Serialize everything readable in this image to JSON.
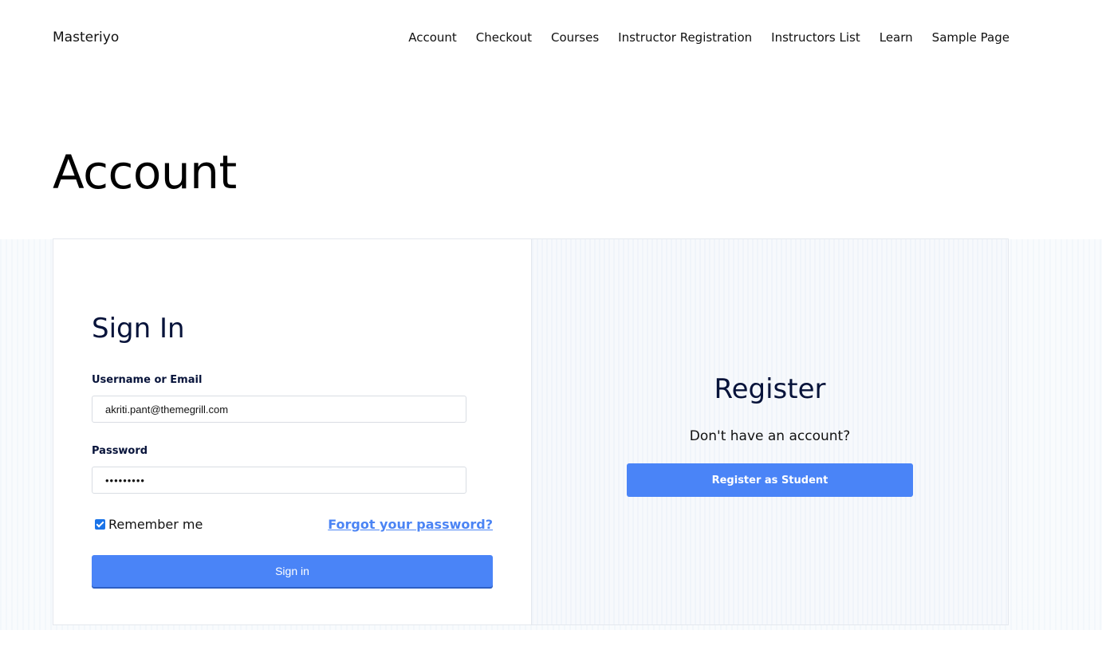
{
  "header": {
    "site_title": "Masteriyo",
    "nav": [
      {
        "label": "Account"
      },
      {
        "label": "Checkout"
      },
      {
        "label": "Courses"
      },
      {
        "label": "Instructor Registration"
      },
      {
        "label": "Instructors List"
      },
      {
        "label": "Learn"
      },
      {
        "label": "Sample Page"
      }
    ]
  },
  "page": {
    "title": "Account"
  },
  "signin": {
    "heading": "Sign In",
    "username_label": "Username or Email",
    "username_value": "akriti.pant@themegrill.com",
    "password_label": "Password",
    "password_value": "•••••••••",
    "remember_label": "Remember me",
    "remember_checked": true,
    "forgot_label": "Forgot your password?",
    "button_label": "Sign in"
  },
  "register": {
    "heading": "Register",
    "prompt": "Don't have an account?",
    "button_label": "Register as Student"
  },
  "colors": {
    "accent": "#4a84f7",
    "link": "#4b84f4",
    "heading": "#07133a"
  }
}
